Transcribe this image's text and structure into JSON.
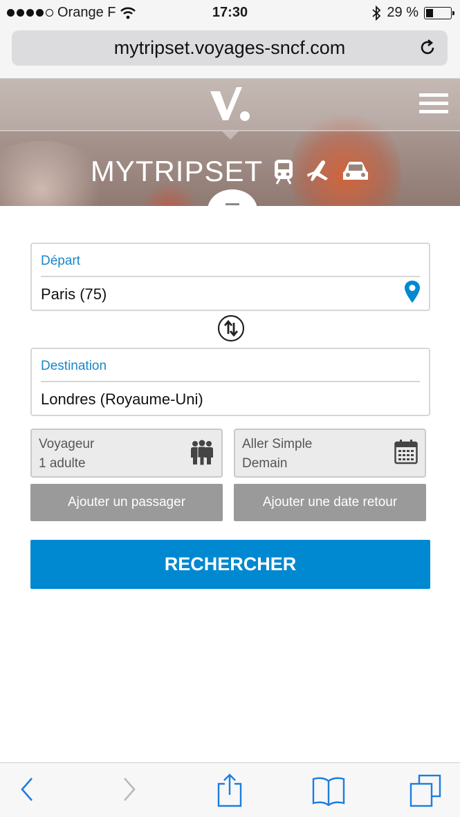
{
  "status_bar": {
    "carrier": "Orange F",
    "time": "17:30",
    "battery": "29 %",
    "battery_level": 0.29
  },
  "browser": {
    "url": "mytripset.voyages-sncf.com"
  },
  "header": {
    "brand": "MYTRIPSET"
  },
  "form": {
    "departure": {
      "label": "Départ",
      "value": "Paris (75)"
    },
    "destination": {
      "label": "Destination",
      "value": "Londres (Royaume-Uni)"
    },
    "traveler": {
      "label": "Voyageur",
      "value": "1 adulte"
    },
    "trip": {
      "label": "Aller Simple",
      "value": "Demain"
    },
    "add_passenger": "Ajouter un passager",
    "add_return_date": "Ajouter une date retour",
    "search": "RECHERCHER"
  },
  "colors": {
    "accent": "#0088d1",
    "label_blue": "#1a86c8",
    "button_gray": "#9a9a9a"
  }
}
